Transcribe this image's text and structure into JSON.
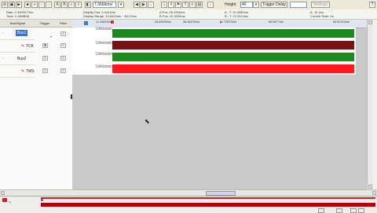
{
  "toolbar": {
    "zoom_value": "7.3666ms/",
    "height_label": "Height",
    "height_value": "40",
    "trigger_delay_label": "Trigger Delay",
    "trigger_delay_value": "",
    "settings_label": "Settings"
  },
  "info": {
    "sample_rate": "Rate: 2.34000 Ph/s",
    "total": "Total: 0.18MB/M",
    "display_pos": "Display Pos: 4.9414ms",
    "display_range": "Display Range: 10.8420ms ~ 84.22ms",
    "a_pos": "A Pos: 16.3340ms",
    "b_pos": "B Pos: 10.3330ms",
    "a_t": "A - T: 10.2950ms",
    "b_t": "B - T: 10.3310ms",
    "a_b": "A - B: 2us",
    "current_rate": "Current Rate: Hz"
  },
  "columns": {
    "bus_signal": "Bus/Signal",
    "trigger": "Trigger",
    "filter": "Filter"
  },
  "signals": [
    {
      "name": "Bus1",
      "selected": true,
      "wave": "Unknown",
      "color": "#1d8a1d"
    },
    {
      "name": "TCK",
      "selected": false,
      "wave": "Unknown",
      "color": "#7a1212"
    },
    {
      "name": "Bus2",
      "selected": false,
      "wave": "Unknown",
      "color": "#1d8a1d"
    },
    {
      "name": "TMS",
      "selected": false,
      "wave": "Unknown",
      "color": "#ff1a1a"
    }
  ],
  "timeline": {
    "ticks": [
      "11.34820ms",
      "25.84530ms",
      "38.46470ms",
      "51.75670ms",
      "66.5677ms",
      "80.87410ms"
    ]
  },
  "overview": {
    "marker_color": "#cc0000"
  }
}
